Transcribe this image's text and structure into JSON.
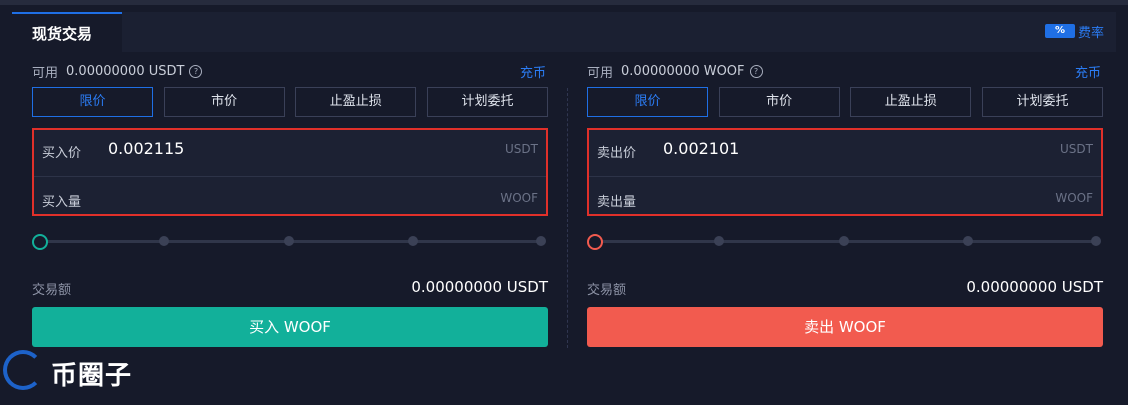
{
  "header": {
    "tab_label": "现货交易",
    "fee_badge": "%",
    "fee_label": "费率"
  },
  "buy_panel": {
    "available_label": "可用",
    "available_value": "0.00000000 USDT",
    "deposit_label": "充币",
    "order_types": [
      "限价",
      "市价",
      "止盈止损",
      "计划委托"
    ],
    "active_order_type": "限价",
    "price_label": "买入价",
    "price_value": "0.002115",
    "price_unit": "USDT",
    "qty_label": "买入量",
    "qty_value": "",
    "qty_unit": "WOOF",
    "slider_percent": 0,
    "amount_label": "交易额",
    "amount_value": "0.00000000 USDT",
    "action_label": "买入 WOOF",
    "accent": "#12b09a"
  },
  "sell_panel": {
    "available_label": "可用",
    "available_value": "0.00000000 WOOF",
    "deposit_label": "充币",
    "order_types": [
      "限价",
      "市价",
      "止盈止损",
      "计划委托"
    ],
    "active_order_type": "限价",
    "price_label": "卖出价",
    "price_value": "0.002101",
    "price_unit": "USDT",
    "qty_label": "卖出量",
    "qty_value": "",
    "qty_unit": "WOOF",
    "slider_percent": 0,
    "amount_label": "交易额",
    "amount_value": "0.00000000 USDT",
    "action_label": "卖出 WOOF",
    "accent": "#f25b4f"
  },
  "watermark": {
    "text": "币圈子"
  },
  "colors": {
    "background": "#161a2a",
    "primary_blue": "#1f6fe5",
    "highlight_red": "#e0302a"
  }
}
